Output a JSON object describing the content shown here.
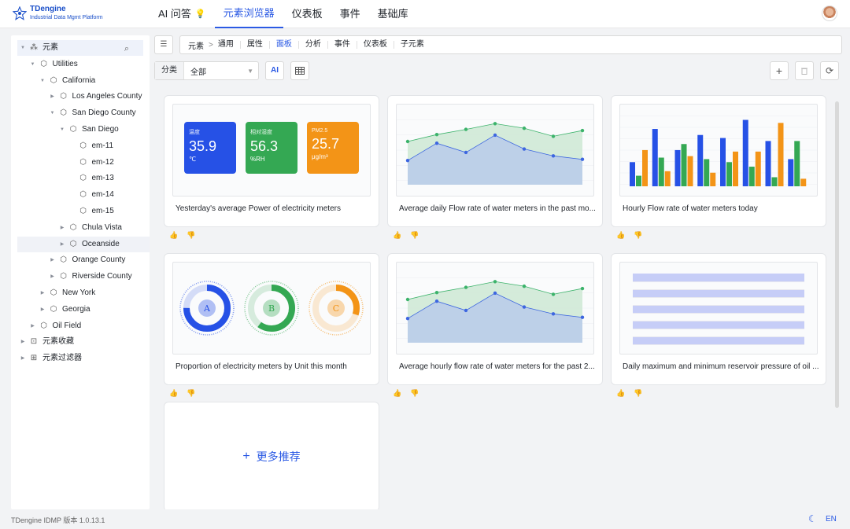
{
  "app": {
    "name": "TDengine",
    "subtitle": "Industrial Data Mgmt Platform"
  },
  "nav": [
    {
      "label": "AI 问答",
      "active": false,
      "icon": "lightbulb-icon"
    },
    {
      "label": "元素浏览器",
      "active": true
    },
    {
      "label": "仪表板",
      "active": false
    },
    {
      "label": "事件",
      "active": false
    },
    {
      "label": "基础库",
      "active": false
    }
  ],
  "tree": [
    {
      "label": "元素",
      "depth": 0,
      "caret": "down",
      "icon": "elements-icon",
      "root": true
    },
    {
      "label": "Utilities",
      "depth": 1,
      "caret": "down",
      "icon": "cube-icon"
    },
    {
      "label": "California",
      "depth": 2,
      "caret": "down",
      "icon": "cube-icon"
    },
    {
      "label": "Los Angeles County",
      "depth": 3,
      "caret": "right",
      "icon": "cube-icon"
    },
    {
      "label": "San Diego County",
      "depth": 3,
      "caret": "down",
      "icon": "cube-icon"
    },
    {
      "label": "San Diego",
      "depth": 4,
      "caret": "down",
      "icon": "cube-icon"
    },
    {
      "label": "em-11",
      "depth": 5,
      "caret": "",
      "icon": "cube-icon"
    },
    {
      "label": "em-12",
      "depth": 5,
      "caret": "",
      "icon": "cube-icon"
    },
    {
      "label": "em-13",
      "depth": 5,
      "caret": "",
      "icon": "cube-icon"
    },
    {
      "label": "em-14",
      "depth": 5,
      "caret": "",
      "icon": "cube-icon"
    },
    {
      "label": "em-15",
      "depth": 5,
      "caret": "",
      "icon": "cube-icon"
    },
    {
      "label": "Chula Vista",
      "depth": 4,
      "caret": "right",
      "icon": "cube-icon"
    },
    {
      "label": "Oceanside",
      "depth": 4,
      "caret": "right",
      "icon": "cube-icon",
      "selected": true
    },
    {
      "label": "Orange County",
      "depth": 3,
      "caret": "right",
      "icon": "cube-icon"
    },
    {
      "label": "Riverside County",
      "depth": 3,
      "caret": "right",
      "icon": "cube-icon"
    },
    {
      "label": "New York",
      "depth": 2,
      "caret": "right",
      "icon": "cube-icon"
    },
    {
      "label": "Georgia",
      "depth": 2,
      "caret": "right",
      "icon": "cube-icon"
    },
    {
      "label": "Oil Field",
      "depth": 1,
      "caret": "right",
      "icon": "cube-icon"
    },
    {
      "label": "元素收藏",
      "depth": 0,
      "caret": "right",
      "icon": "favorites-icon"
    },
    {
      "label": "元素过滤器",
      "depth": 0,
      "caret": "right",
      "icon": "filter-icon"
    }
  ],
  "breadcrumb": {
    "element": "元素",
    "separator": ">"
  },
  "tabs": [
    {
      "label": "通用",
      "active": false
    },
    {
      "label": "属性",
      "active": false
    },
    {
      "label": "面板",
      "active": true
    },
    {
      "label": "分析",
      "active": false
    },
    {
      "label": "事件",
      "active": false
    },
    {
      "label": "仪表板",
      "active": false
    },
    {
      "label": "子元素",
      "active": false
    }
  ],
  "toolbar": {
    "category_label": "分类",
    "category_value": "全部",
    "ai_label": "AI"
  },
  "cards": [
    {
      "title": "Yesterday's average Power of electricity meters",
      "preview": "stats"
    },
    {
      "title": "Average daily Flow rate of water meters in the past mo...",
      "preview": "area"
    },
    {
      "title": "Hourly Flow rate of water meters today",
      "preview": "bars"
    },
    {
      "title": "Proportion of electricity meters by Unit this month",
      "preview": "gauges"
    },
    {
      "title": "Average hourly flow rate of water meters for the past 2...",
      "preview": "area"
    },
    {
      "title": "Daily maximum and minimum reservoir pressure of oil ...",
      "preview": "table"
    }
  ],
  "stats": [
    {
      "label": "温度",
      "value": "35.9",
      "unit": "℃",
      "color": "#2651e6"
    },
    {
      "label": "相对湿度",
      "value": "56.3",
      "unit": "%RH",
      "color": "#34a853"
    },
    {
      "label": "PM2.5",
      "value": "25.7",
      "unit": "μg/m³",
      "color": "#f39417"
    }
  ],
  "gauges": [
    {
      "label": "A",
      "color": "#2651e6",
      "fraction": 0.75
    },
    {
      "label": "B",
      "color": "#34a853",
      "fraction": 0.6
    },
    {
      "label": "C",
      "color": "#f39417",
      "fraction": 0.3
    }
  ],
  "more": {
    "label": "更多推荐"
  },
  "footer": {
    "version": "TDengine IDMP 版本 1.0.13.1",
    "lang": "EN"
  },
  "colors": {
    "accent": "#2b5ae4",
    "blue": "#2651e6",
    "green": "#34a853",
    "orange": "#f39417"
  },
  "chart_data": [
    {
      "type": "area",
      "series": [
        {
          "values": [
            4.2,
            7.2,
            5.6,
            8.6,
            6.2,
            5.0,
            4.4
          ]
        },
        {
          "values": [
            7.5,
            8.7,
            9.6,
            10.6,
            9.8,
            8.4,
            9.4
          ]
        }
      ]
    },
    {
      "type": "bar",
      "series": [
        {
          "values": [
            3.2,
            7.6,
            4.8,
            6.8,
            6.4,
            8.8,
            6.0,
            3.6
          ]
        },
        {
          "values": [
            1.4,
            3.8,
            5.6,
            3.6,
            3.2,
            2.6,
            1.2,
            6.0
          ]
        },
        {
          "values": [
            4.8,
            2.0,
            4.0,
            1.8,
            4.6,
            4.6,
            8.4,
            1.0
          ]
        }
      ]
    },
    {
      "type": "area",
      "series": [
        {
          "values": [
            4.2,
            7.2,
            5.6,
            8.6,
            6.2,
            5.0,
            4.4
          ]
        },
        {
          "values": [
            7.5,
            8.7,
            9.6,
            10.6,
            9.8,
            8.4,
            9.4
          ]
        }
      ]
    }
  ]
}
